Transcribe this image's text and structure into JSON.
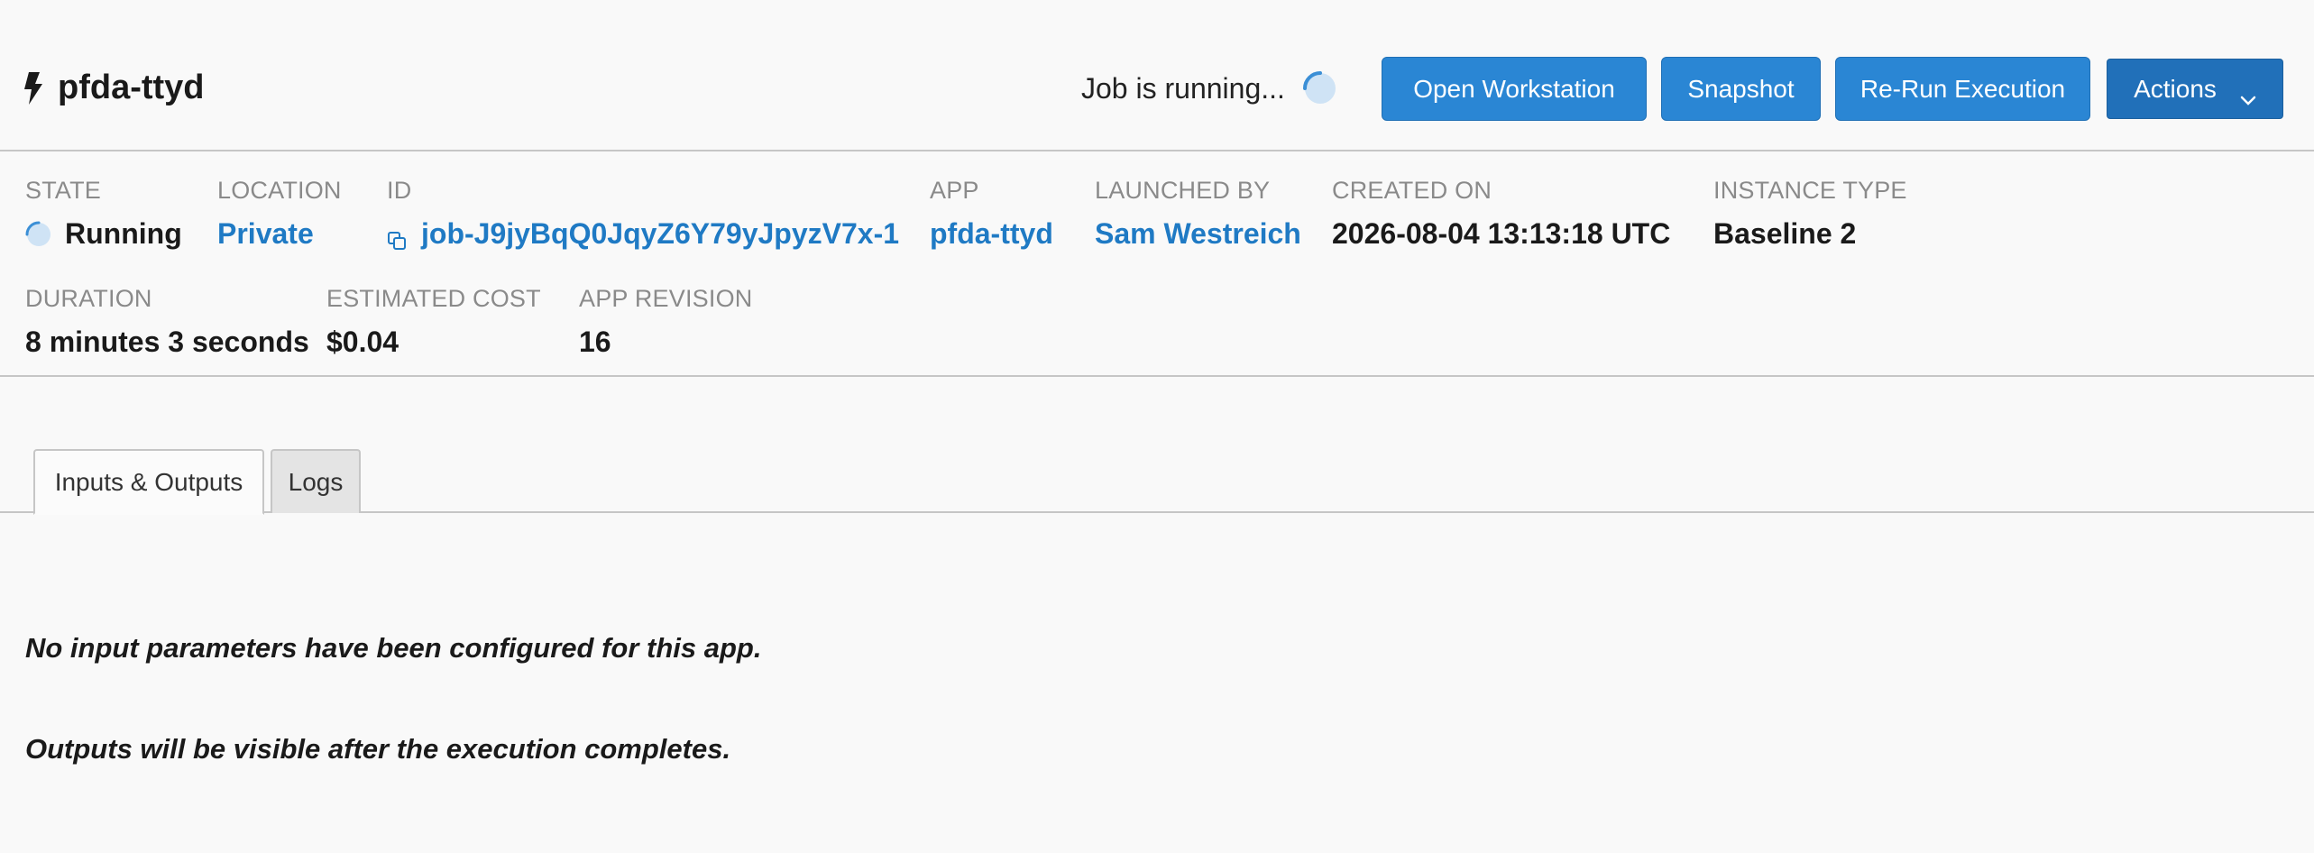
{
  "header": {
    "job_name": "pfda-ttyd",
    "status_text": "Job is running...",
    "buttons": {
      "open_workstation": "Open Workstation",
      "snapshot": "Snapshot",
      "rerun": "Re-Run Execution",
      "actions": "Actions"
    }
  },
  "meta": {
    "state": {
      "label": "STATE",
      "value": "Running"
    },
    "location": {
      "label": "LOCATION",
      "value": "Private"
    },
    "id": {
      "label": "ID",
      "value": "job-J9jyBqQ0JqyZ6Y79yJpyzV7x-1"
    },
    "app": {
      "label": "APP",
      "value": "pfda-ttyd"
    },
    "launched_by": {
      "label": "LAUNCHED BY",
      "value": "Sam Westreich"
    },
    "created_on": {
      "label": "CREATED ON",
      "value": "2026-08-04 13:13:18 UTC"
    },
    "instance_type": {
      "label": "INSTANCE TYPE",
      "value": "Baseline 2"
    },
    "duration": {
      "label": "DURATION",
      "value": "8 minutes 3 seconds"
    },
    "estimated_cost": {
      "label": "ESTIMATED COST",
      "value": "$0.04"
    },
    "app_revision": {
      "label": "APP REVISION",
      "value": "16"
    }
  },
  "tabs": [
    {
      "label": "Inputs & Outputs",
      "active": true
    },
    {
      "label": "Logs",
      "active": false
    }
  ],
  "content": {
    "inputs_message": "No input parameters have been configured for this app.",
    "outputs_message": "Outputs will be visible after the execution completes."
  },
  "colors": {
    "primary_button": "#2a86d4",
    "link": "#1f7ac4",
    "label": "#8a8a8a"
  }
}
